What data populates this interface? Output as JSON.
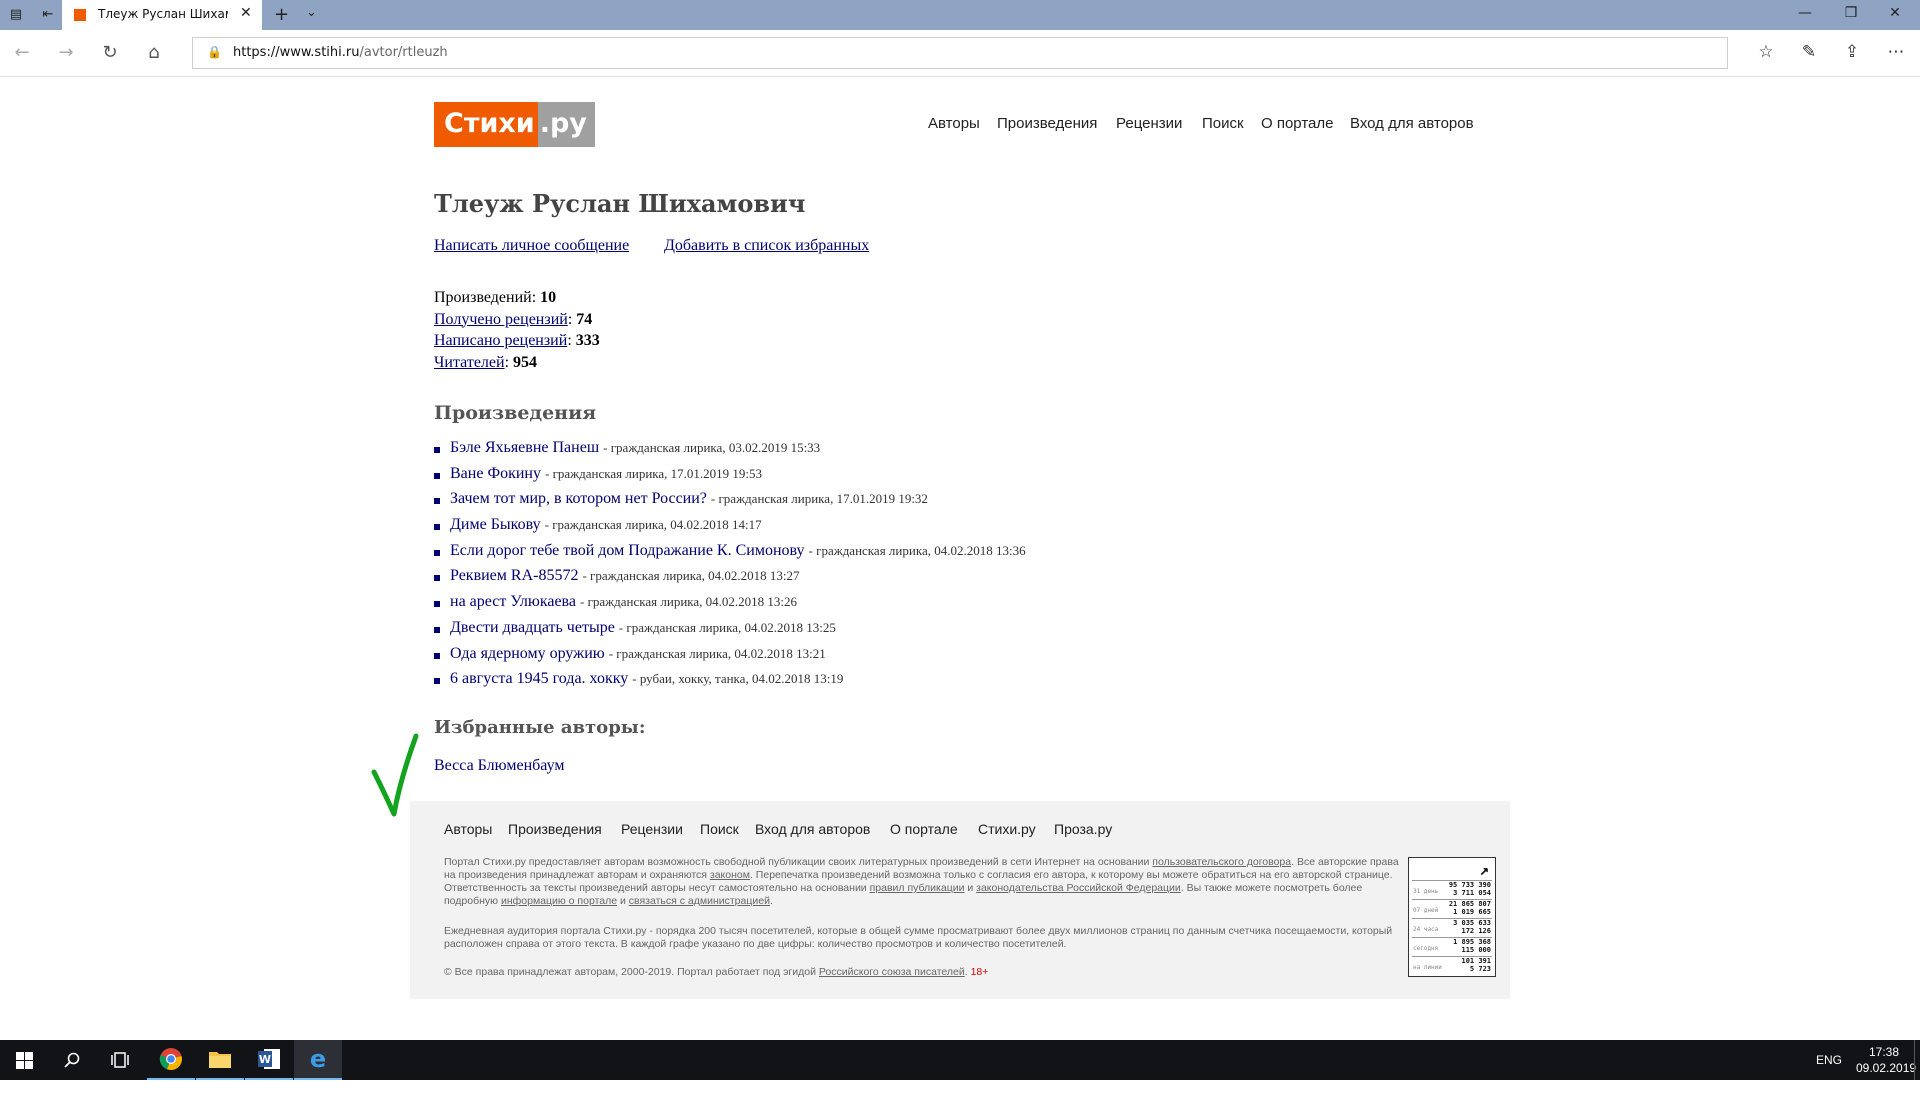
{
  "browser": {
    "tab_title": "Тлеуж Руслан Шихамові",
    "url_domain": "https://www.stihi.ru",
    "url_path": "/avtor/rtleuzh"
  },
  "site": {
    "logo_part1": "Стихи",
    "logo_part2": ".ру",
    "brand_color": "#f05a00",
    "nav": [
      "Авторы",
      "Произведения",
      "Рецензии",
      "Поиск",
      "О портале",
      "Вход для авторов"
    ]
  },
  "author": {
    "name": "Тлеуж Руслан Шихамович",
    "action_message": "Написать личное сообщение",
    "action_favorite": "Добавить в список избранных"
  },
  "stats": {
    "works_label": "Произведений",
    "works_value": "10",
    "received_label": "Получено рецензий",
    "received_value": "74",
    "written_label": "Написано рецензий",
    "written_value": "333",
    "readers_label": "Читателей",
    "readers_value": "954"
  },
  "works_heading": "Произведения",
  "works": [
    {
      "title": "Бэле Яхьяевне Панеш",
      "meta": "- гражданская лирика, 03.02.2019 15:33"
    },
    {
      "title": "Ване Фокину",
      "meta": "- гражданская лирика, 17.01.2019 19:53"
    },
    {
      "title": "Зачем тот мир, в котором нет России?",
      "meta": "- гражданская лирика, 17.01.2019 19:32"
    },
    {
      "title": "Диме Быкову",
      "meta": "- гражданская лирика, 04.02.2018 14:17"
    },
    {
      "title": "Если дорог тебе твой дом Подражание К. Симонову",
      "meta": "- гражданская лирика, 04.02.2018 13:36"
    },
    {
      "title": "Реквием RA-85572",
      "meta": "- гражданская лирика, 04.02.2018 13:27"
    },
    {
      "title": "на арест Улюкаева",
      "meta": "- гражданская лирика, 04.02.2018 13:26"
    },
    {
      "title": "Двести двадцать четыре",
      "meta": "- гражданская лирика, 04.02.2018 13:25"
    },
    {
      "title": "Ода ядерному оружию",
      "meta": "- гражданская лирика, 04.02.2018 13:21"
    },
    {
      "title": "6 августа 1945 года. хокку",
      "meta": "- рубаи, хокку, танка, 04.02.2018 13:19"
    }
  ],
  "favorites_heading": "Избранные авторы:",
  "favorites": [
    "Весса Блюменбаум"
  ],
  "footer": {
    "nav": [
      "Авторы",
      "Произведения",
      "Рецензии",
      "Поиск",
      "Вход для авторов",
      "О портале",
      "Стихи.ру",
      "Проза.ру"
    ],
    "p1_a": "Портал Стихи.ру предоставляет авторам возможность свободной публикации своих литературных произведений в сети Интернет на основании ",
    "p1_link1": "пользовательского договора",
    "p1_b": ". Все авторские права на произведения принадлежат авторам и охраняются ",
    "p1_link2": "законом",
    "p1_c": ". Перепечатка произведений возможна только с согласия его автора, к которому вы можете обратиться на его авторской странице. Ответственность за тексты произведений авторы несут самостоятельно на основании ",
    "p1_link3": "правил публикации",
    "p1_d": " и ",
    "p1_link4": "законодательства Российской Федерации",
    "p1_e": ". Вы также можете посмотреть более подробную ",
    "p1_link5": "информацию о портале",
    "p1_f": " и ",
    "p1_link6": "связаться с администрацией",
    "p1_g": ".",
    "p2": "Ежедневная аудитория портала Стихи.ру - порядка 200 тысяч посетителей, которые в общей сумме просматривают более двух миллионов страниц по данным счетчика посещаемости, который расположен справа от этого текста. В каждой графе указано по две цифры: количество просмотров и количество посетителей.",
    "copy_a": "© Все права принадлежат авторам, 2000-2019.   Портал работает под эгидой ",
    "copy_link": "Российского союза писателей",
    "copy_b": ".",
    "age": "18+"
  },
  "counter": {
    "rows": [
      {
        "label": "31 день",
        "v1": "95 733 390",
        "v2": "3 711 054"
      },
      {
        "label": "07 дней",
        "v1": "21 865 807",
        "v2": "1 019 665"
      },
      {
        "label": "24 часа",
        "v1": "3 035 633",
        "v2": "172 126"
      },
      {
        "label": "сегодня",
        "v1": "1 895 368",
        "v2": "115 000"
      },
      {
        "label": "на линии",
        "v1": "101 391",
        "v2": "5 723"
      }
    ]
  },
  "taskbar": {
    "lang": "ENG",
    "time": "17:38",
    "date": "09.02.2019"
  }
}
